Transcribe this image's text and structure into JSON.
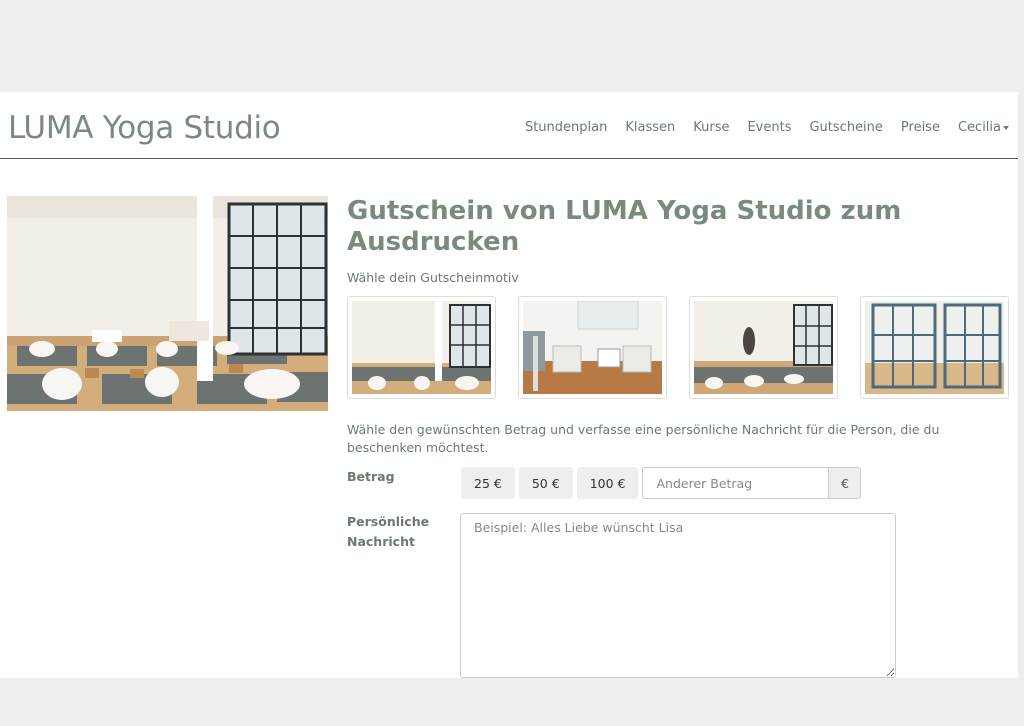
{
  "brand": "LUMA Yoga Studio",
  "nav": {
    "items": [
      "Stundenplan",
      "Klassen",
      "Kurse",
      "Events",
      "Gutscheine",
      "Preise"
    ],
    "user": "Cecilia"
  },
  "voucher": {
    "title": "Gutschein von LUMA Yoga Studio zum Ausdrucken",
    "choose_motif": "Wähle dein Gutscheinmotiv",
    "description": "Wähle den gewünschten Betrag und verfasse eine persönliche Nachricht für die Person, die du beschenken möchtest.",
    "amount_label": "Betrag",
    "amounts": [
      "25 €",
      "50 €",
      "100 €"
    ],
    "other_amount_placeholder": "Anderer Betrag",
    "currency": "€",
    "message_label_line1": "Persönliche",
    "message_label_line2": "Nachricht",
    "message_placeholder": "Beispiel: Alles Liebe wünscht Lisa"
  },
  "colors": {
    "brand_green": "#7a8b7e",
    "text": "#6a7a6e",
    "button_bg": "#eeeeee",
    "page_bg": "#eeeeec"
  }
}
